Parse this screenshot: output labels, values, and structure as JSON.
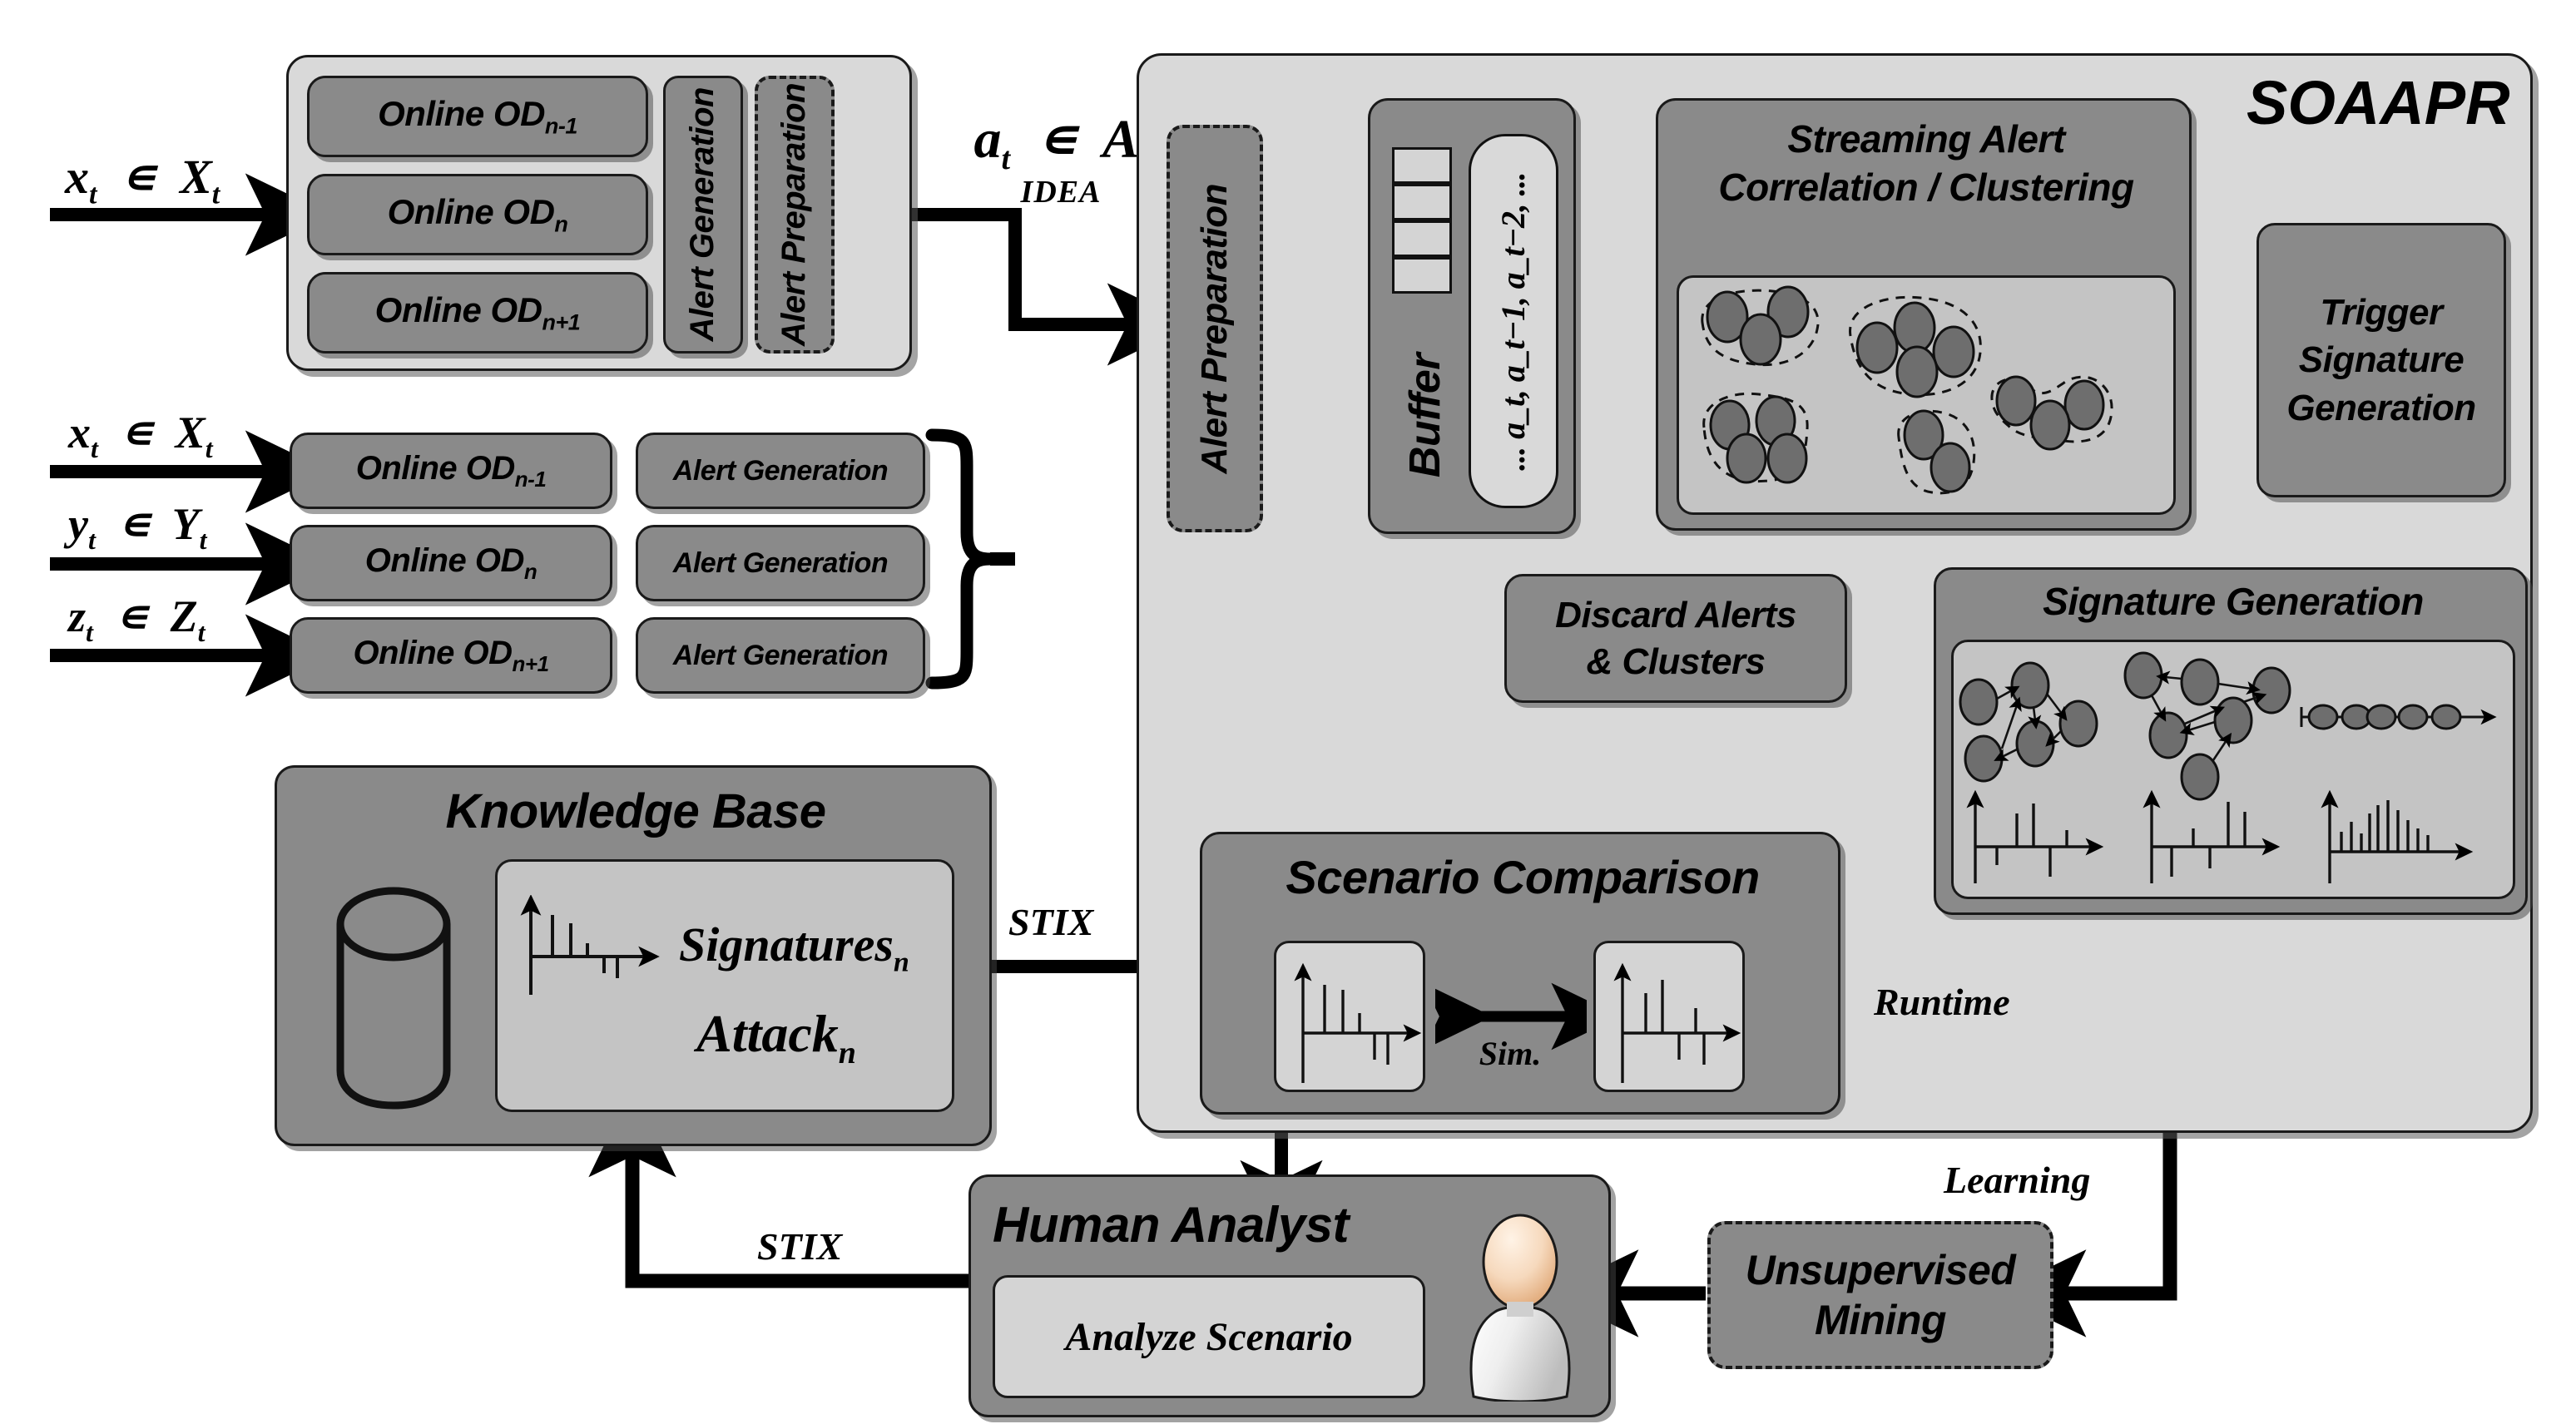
{
  "diagram": {
    "title": "SOAAPR",
    "inputs_top": [
      {
        "label": "x_t ∈ X_t",
        "main": "x",
        "sub": "t",
        "set": "X",
        "setsub": "t"
      }
    ],
    "inputs_multi": [
      {
        "main": "x",
        "sub": "t",
        "set": "X",
        "setsub": "t"
      },
      {
        "main": "y",
        "sub": "t",
        "set": "Y",
        "setsub": "t"
      },
      {
        "main": "z",
        "sub": "t",
        "set": "Z",
        "setsub": "t"
      }
    ],
    "od_group_top": {
      "items": [
        "Online OD",
        "Online OD",
        "Online OD"
      ],
      "subscripts": [
        "n-1",
        "n",
        "n+1"
      ],
      "side_labels": [
        "Alert Generation",
        "Alert Preparation"
      ]
    },
    "od_group_bottom": {
      "items": [
        "Online OD",
        "Online OD",
        "Online OD"
      ],
      "subscripts": [
        "n-1",
        "n",
        "n+1"
      ],
      "alert_gen_label": "Alert Generation"
    },
    "alert_edge": {
      "expr": "a_t ∈ A_t",
      "format": "IDEA"
    },
    "soaapr": {
      "alert_preparation": "Alert Preparation",
      "buffer": {
        "title": "Buffer",
        "contents": "... a_t, a_t−1, a_t−2, ..."
      },
      "clustering": {
        "title_line1": "Streaming Alert",
        "title_line2": "Correlation / Clustering",
        "cluster_count": 5,
        "node_counts": [
          3,
          4,
          4,
          2,
          3
        ]
      },
      "trigger_signature": {
        "line1": "Trigger",
        "line2": "Signature",
        "line3": "Generation"
      },
      "discard": {
        "line1": "Discard Alerts",
        "line2": "& Clusters"
      },
      "signature_generation": {
        "title": "Signature Generation"
      },
      "scenario_comparison": {
        "title": "Scenario Comparison",
        "similarity_label": "Sim."
      }
    },
    "knowledge_base": {
      "title": "Knowledge Base",
      "signatures": "Signatures",
      "signatures_sub": "n",
      "attack": "Attack",
      "attack_sub": "n"
    },
    "human_analyst": {
      "title": "Human Analyst",
      "action": "Analyze Scenario"
    },
    "unsupervised_mining": {
      "line1": "Unsupervised",
      "line2": "Mining"
    },
    "edge_labels": {
      "stix_kb_to_scenario": "STIX",
      "stix_analyst_to_kb": "STIX",
      "runtime": "Runtime",
      "learning": "Learning"
    },
    "colors": {
      "panel_light": "#d9d9d9",
      "panel_mid": "#8a8a8a",
      "panel_inner": "#c4c4c4",
      "node_fill": "#6e6e6e",
      "stroke": "#1a1a1a",
      "background": "#ffffff"
    }
  }
}
